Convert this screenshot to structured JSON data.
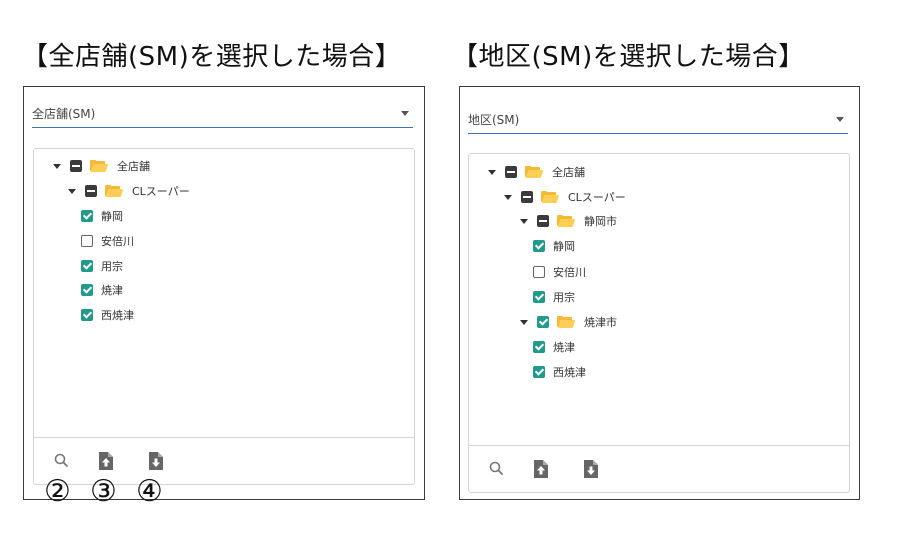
{
  "captions": {
    "all_stores": "【全店舗(SM)を選択した場合】",
    "district": "【地区(SM)を選択した場合】"
  },
  "left_panel": {
    "select_value": "全店舗(SM)",
    "tree": {
      "root": "全店舗",
      "group": "CLスーパー",
      "stores": [
        {
          "label": "静岡",
          "checked": true
        },
        {
          "label": "安倍川",
          "checked": false
        },
        {
          "label": "用宗",
          "checked": true
        },
        {
          "label": "焼津",
          "checked": true
        },
        {
          "label": "西焼津",
          "checked": true
        }
      ]
    },
    "footer_icons": [
      "search-icon",
      "upload-file-icon",
      "download-file-icon"
    ]
  },
  "right_panel": {
    "select_value": "地区(SM)",
    "tree": {
      "root": "全店舗",
      "group": "CLスーパー",
      "districts": [
        {
          "label": "静岡市",
          "state": "indeterminate",
          "stores": [
            {
              "label": "静岡",
              "checked": true
            },
            {
              "label": "安倍川",
              "checked": false
            },
            {
              "label": "用宗",
              "checked": true
            }
          ]
        },
        {
          "label": "焼津市",
          "state": "checked",
          "stores": [
            {
              "label": "焼津",
              "checked": true
            },
            {
              "label": "西焼津",
              "checked": true
            }
          ]
        }
      ]
    },
    "footer_icons": [
      "search-icon",
      "upload-file-icon",
      "download-file-icon"
    ]
  },
  "annotations": [
    "②",
    "③",
    "④"
  ],
  "colors": {
    "checkbox_checked": "#1f9a8b",
    "checkbox_indeterminate": "#3b3b3b",
    "folder": "#f5b93a",
    "select_underline": "#3d6fc2"
  }
}
